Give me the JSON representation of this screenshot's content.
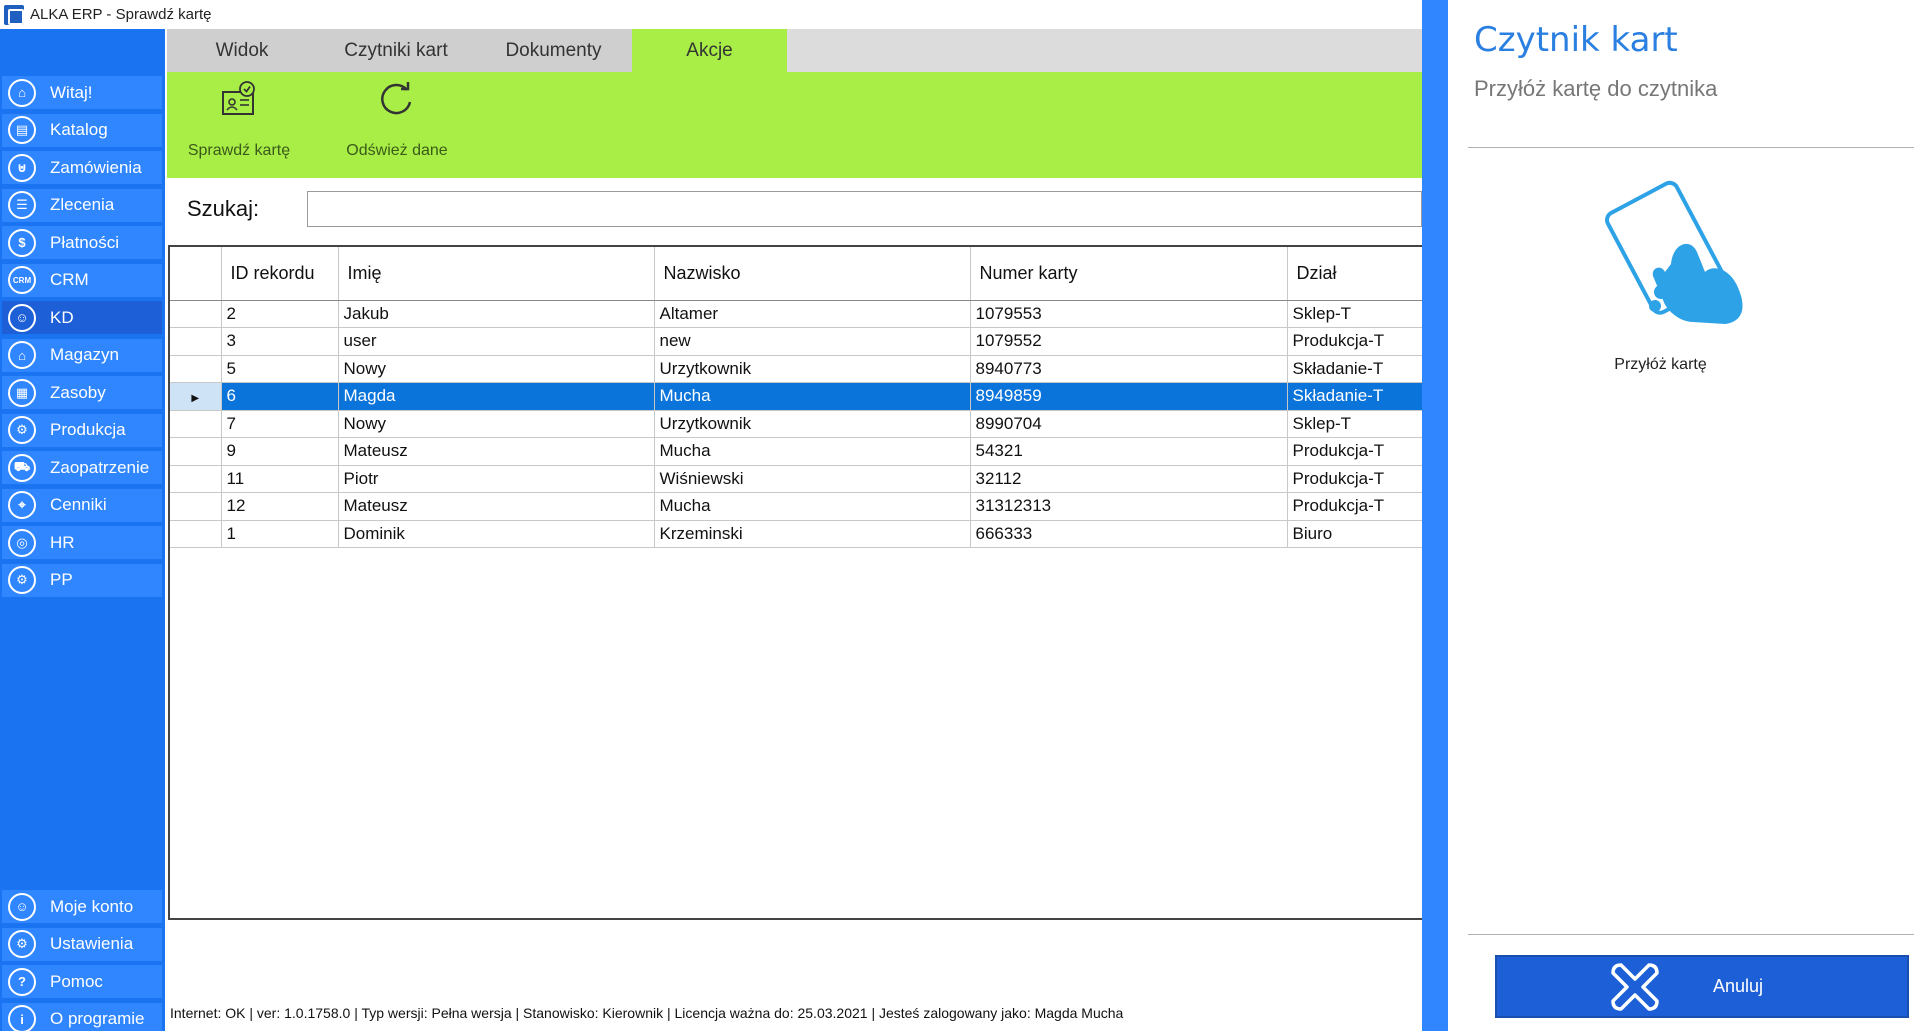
{
  "window": {
    "title": "ALKA ERP - Sprawdź kartę"
  },
  "sidebar": {
    "items": [
      {
        "label": "Witaj!",
        "icon": "home-icon",
        "glyph": "⌂"
      },
      {
        "label": "Katalog",
        "icon": "book-icon",
        "glyph": "▤"
      },
      {
        "label": "Zamówienia",
        "icon": "cart-icon",
        "glyph": "⊍"
      },
      {
        "label": "Zlecenia",
        "icon": "list-icon",
        "glyph": "☰"
      },
      {
        "label": "Płatności",
        "icon": "dollar-icon",
        "glyph": "$"
      },
      {
        "label": "CRM",
        "icon": "crm-icon",
        "glyph": "CRM"
      },
      {
        "label": "KD",
        "icon": "person-icon",
        "glyph": "☺"
      },
      {
        "label": "Magazyn",
        "icon": "warehouse-icon",
        "glyph": "⌂"
      },
      {
        "label": "Zasoby",
        "icon": "resources-icon",
        "glyph": "▦"
      },
      {
        "label": "Produkcja",
        "icon": "production-icon",
        "glyph": "⚙"
      },
      {
        "label": "Zaopatrzenie",
        "icon": "truck-icon",
        "glyph": "⛟"
      },
      {
        "label": "Cenniki",
        "icon": "price-tag-icon",
        "glyph": "⌖"
      },
      {
        "label": "HR",
        "icon": "hr-icon",
        "glyph": "◎"
      },
      {
        "label": "PP",
        "icon": "pp-icon",
        "glyph": "⚙"
      }
    ],
    "bottom_items": [
      {
        "label": "Moje konto",
        "icon": "account-icon",
        "glyph": "☺"
      },
      {
        "label": "Ustawienia",
        "icon": "settings-icon",
        "glyph": "⚙"
      },
      {
        "label": "Pomoc",
        "icon": "help-icon",
        "glyph": "?"
      },
      {
        "label": "O programie",
        "icon": "info-icon",
        "glyph": "i"
      }
    ]
  },
  "tabs": [
    {
      "label": "Widok"
    },
    {
      "label": "Czytniki kart"
    },
    {
      "label": "Dokumenty"
    },
    {
      "label": "Akcje"
    }
  ],
  "ribbon": {
    "check_card": "Sprawdź kartę",
    "refresh": "Odśwież dane"
  },
  "search": {
    "label": "Szukaj:",
    "value": ""
  },
  "grid": {
    "columns": [
      "ID rekordu",
      "Imię",
      "Nazwisko",
      "Numer karty",
      "Dział"
    ],
    "rows": [
      {
        "id": "2",
        "imie": "Jakub",
        "nazwisko": "Altamer",
        "numer": "1079553",
        "dzial": "Sklep-T"
      },
      {
        "id": "3",
        "imie": "user",
        "nazwisko": "new",
        "numer": "1079552",
        "dzial": "Produkcja-T"
      },
      {
        "id": "5",
        "imie": "Nowy",
        "nazwisko": "Urzytkownik",
        "numer": "8940773",
        "dzial": "Składanie-T"
      },
      {
        "id": "6",
        "imie": "Magda",
        "nazwisko": "Mucha",
        "numer": "8949859",
        "dzial": "Składanie-T"
      },
      {
        "id": "7",
        "imie": "Nowy",
        "nazwisko": "Urzytkownik",
        "numer": "8990704",
        "dzial": "Sklep-T"
      },
      {
        "id": "9",
        "imie": "Mateusz",
        "nazwisko": "Mucha",
        "numer": "54321",
        "dzial": "Produkcja-T"
      },
      {
        "id": "11",
        "imie": "Piotr",
        "nazwisko": "Wiśniewski",
        "numer": "32112",
        "dzial": "Produkcja-T"
      },
      {
        "id": "12",
        "imie": "Mateusz",
        "nazwisko": "Mucha",
        "numer": "31312313",
        "dzial": "Produkcja-T"
      },
      {
        "id": "1",
        "imie": "Dominik",
        "nazwisko": "Krzeminski",
        "numer": "666333",
        "dzial": "Biuro"
      }
    ],
    "selected_row_index": 3,
    "row_marker": "▶"
  },
  "status": {
    "text": "Internet: OK  |   ver: 1.0.1758.0   |   Typ wersji: Pełna wersja   |   Stanowisko: Kierownik   |   Licencja ważna do: 25.03.2021   |   Jesteś zalogowany jako: Magda Mucha"
  },
  "panel": {
    "title": "Czytnik kart",
    "subtitle": "Przyłóż kartę do czytnika",
    "card_label": "Przyłóż kartę",
    "cancel_label": "Anuluj"
  },
  "colors": {
    "sidebar": "#1a73f0",
    "ribbon_green": "#a9ee46",
    "selection": "#0a74da",
    "accent_blue": "#2a7fe0"
  }
}
